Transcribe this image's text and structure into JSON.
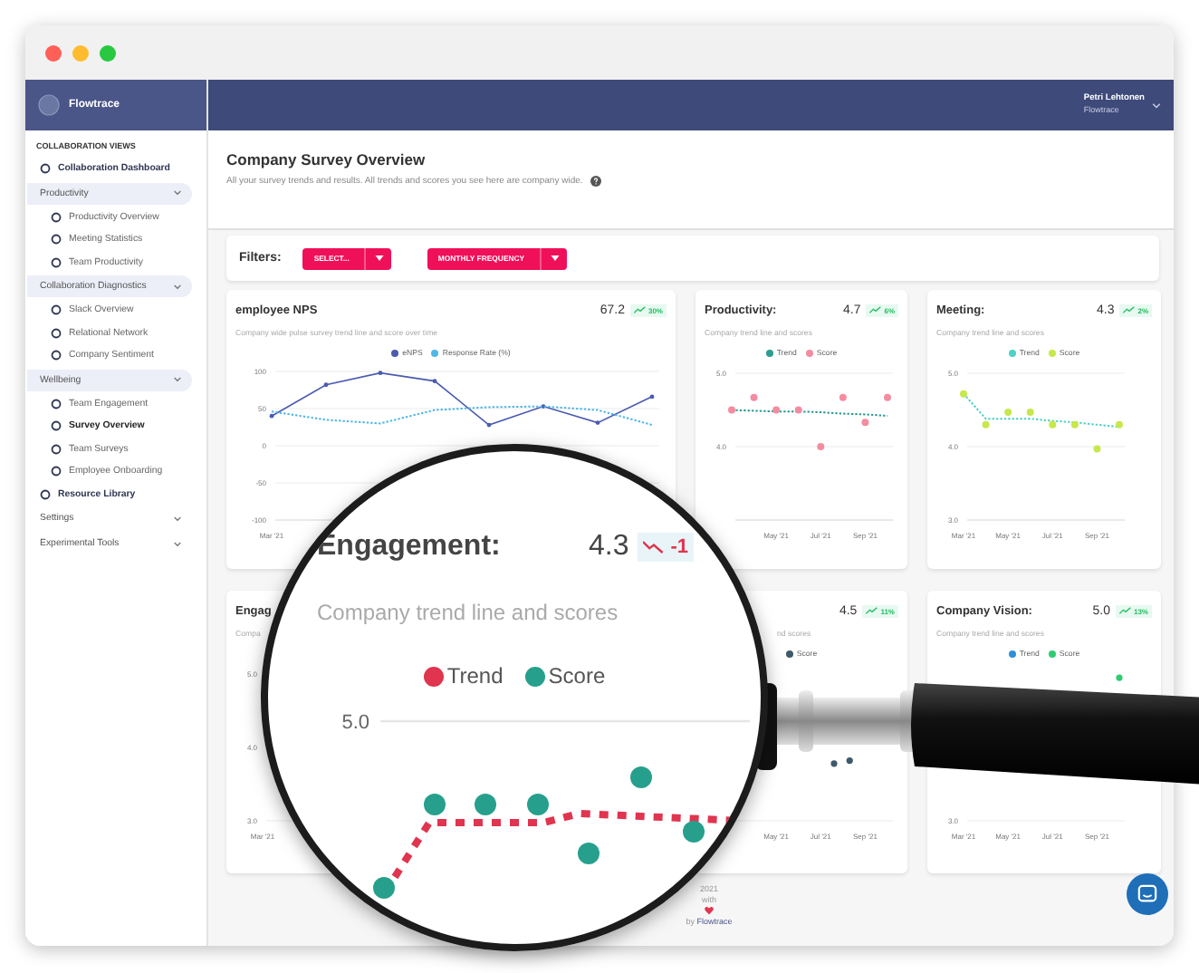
{
  "window": {
    "buttons": [
      {
        "kind": "close"
      },
      {
        "kind": "minimize"
      },
      {
        "kind": "zoom"
      }
    ]
  },
  "sidebar": {
    "brand": "Flowtrace",
    "items": [
      {
        "kind": "heading",
        "label": "COLLABORATION VIEWS"
      },
      {
        "kind": "link",
        "label": "Collaboration Dashboard",
        "selected": false
      },
      {
        "kind": "group",
        "label": "Productivity",
        "expanded": true,
        "children": [
          {
            "label": "Productivity Overview",
            "selected": false
          },
          {
            "label": "Meeting Statistics",
            "selected": false
          },
          {
            "label": "Team Productivity",
            "selected": false
          }
        ]
      },
      {
        "kind": "group",
        "label": "Collaboration Diagnostics",
        "expanded": true,
        "children": [
          {
            "label": "Slack Overview",
            "selected": false
          },
          {
            "label": "Relational Network",
            "selected": false
          },
          {
            "label": "Company Sentiment",
            "selected": false
          }
        ]
      },
      {
        "kind": "group",
        "label": "Wellbeing",
        "expanded": true,
        "children": [
          {
            "label": "Team Engagement",
            "selected": false
          },
          {
            "label": "Survey Overview",
            "selected": true
          },
          {
            "label": "Team Surveys",
            "selected": false
          },
          {
            "label": "Employee Onboarding",
            "selected": false
          }
        ]
      },
      {
        "kind": "link",
        "label": "Resource Library",
        "selected": false
      },
      {
        "kind": "group",
        "label": "Settings",
        "expanded": false
      },
      {
        "kind": "group",
        "label": "Experimental Tools",
        "expanded": false
      }
    ]
  },
  "user": {
    "name": "Petri Lehtonen",
    "org": "Flowtrace"
  },
  "page": {
    "title": "Company Survey Overview",
    "subtitle": "All your survey trends and results. All trends and scores you see here are company wide."
  },
  "filters": {
    "label": "Filters:",
    "dropdowns": [
      "SELECT...",
      "MONTHLY FREQUENCY"
    ]
  },
  "card_rows": [
    [
      {
        "title": "employee NPS",
        "value": "67.2",
        "change": "30%",
        "rising": true,
        "subtitle": "Company wide pulse survey trend line and score over time",
        "chart_data": {
          "type": "line",
          "categories": [
            "Mar '21",
            null,
            null,
            null,
            null,
            null,
            null,
            null
          ],
          "ylim": [
            -100,
            100
          ],
          "yticks": [
            100,
            50,
            0,
            -50,
            -100
          ],
          "grid": true,
          "series": [
            {
              "name": "eNPS",
              "type": "line",
              "line_style": "solid",
              "color": "#4a5bb0",
              "values": [
                40,
                82,
                98,
                87,
                28,
                53,
                31,
                66
              ]
            },
            {
              "name": "Response Rate (%)",
              "type": "line",
              "line_style": "dotted",
              "color": "#4fb6e6",
              "values": [
                46,
                35,
                30,
                48,
                52,
                53,
                48,
                28
              ]
            }
          ]
        }
      },
      {
        "title": "Productivity:",
        "value": "4.7",
        "change": "6%",
        "rising": true,
        "subtitle": "Company trend line and scores",
        "chart_data": {
          "type": "scatter",
          "categories": [
            null,
            null,
            "May '21",
            null,
            "Jul '21",
            null,
            "Sep '21",
            null
          ],
          "ylim": [
            3,
            5
          ],
          "yticks": [
            {
              "value": 5,
              "label": "5.0"
            },
            {
              "value": 4,
              "label": "4.0"
            }
          ],
          "grid": true,
          "series": [
            {
              "name": "Trend",
              "type": "line",
              "line_style": "dotted",
              "color": "#2a9d8f",
              "values": [
                4.5,
                4.49,
                4.48,
                4.48,
                4.47,
                4.45,
                4.44,
                4.42
              ]
            },
            {
              "name": "Score",
              "type": "scatter",
              "color": "#f48ca0",
              "values": [
                4.5,
                4.67,
                4.5,
                4.5,
                4.0,
                4.67,
                4.33,
                4.67
              ]
            }
          ]
        }
      },
      {
        "title": "Meeting:",
        "value": "4.3",
        "change": "2%",
        "rising": true,
        "subtitle": "Company trend line and scores",
        "chart_data": {
          "type": "scatter",
          "categories": [
            "Mar '21",
            null,
            "May '21",
            null,
            "Jul '21",
            null,
            "Sep '21",
            null
          ],
          "ylim": [
            3,
            5
          ],
          "yticks": [
            {
              "value": 5,
              "label": "5.0"
            },
            {
              "value": 4,
              "label": "4.0"
            },
            {
              "value": 3,
              "label": "3.0"
            }
          ],
          "grid": true,
          "series": [
            {
              "name": "Trend",
              "type": "line",
              "line_style": "dotted",
              "color": "#4fd1c5",
              "values": [
                4.72,
                4.38,
                4.38,
                4.38,
                4.35,
                4.33,
                4.3,
                4.27
              ]
            },
            {
              "name": "Score",
              "type": "scatter",
              "color": "#c6e84a",
              "values": [
                4.72,
                4.3,
                4.47,
                4.47,
                4.3,
                4.3,
                3.97,
                4.3
              ]
            }
          ]
        }
      }
    ],
    [
      {
        "kind": "partial-left",
        "title": "Engag",
        "subtitle": "Compa",
        "y_labels": [
          "5.0",
          "4.0",
          "3.0"
        ],
        "x_labels": [
          "Mar '21"
        ]
      },
      {
        "kind": "partial-right",
        "value": "4.5",
        "change": "11%",
        "rising": true,
        "subtitle": "nd scores",
        "legend": [
          {
            "label": "Score",
            "color": "#3d5a6b"
          }
        ],
        "x_labels": [
          "May '21",
          "Jul '21",
          "Sep '21"
        ]
      },
      {
        "kind": "full",
        "title": "Company Vision:",
        "value": "5.0",
        "change": "13%",
        "rising": true,
        "subtitle": "Company trend line and scores",
        "legend": [
          {
            "label": "Trend",
            "color": "#2f8fd8"
          },
          {
            "label": "Score",
            "color": "#2ecc71"
          }
        ],
        "y_labels": [
          "3.0"
        ],
        "x_labels": [
          "Mar '21",
          "May '21",
          "Jul '21",
          "Sep '21"
        ]
      }
    ]
  ],
  "magnifier": {
    "title": "Engagement:",
    "value": "4.3",
    "change": "-1",
    "rising": false,
    "subtitle": "Company trend line and scores",
    "legend": [
      {
        "label": "Trend",
        "color": "#e0344f"
      },
      {
        "label": "Score",
        "color": "#26a08c"
      }
    ],
    "y_label": "5.0"
  },
  "footer": {
    "year": "2021",
    "made": "with",
    "by": "by",
    "brand": "Flowtrace"
  }
}
